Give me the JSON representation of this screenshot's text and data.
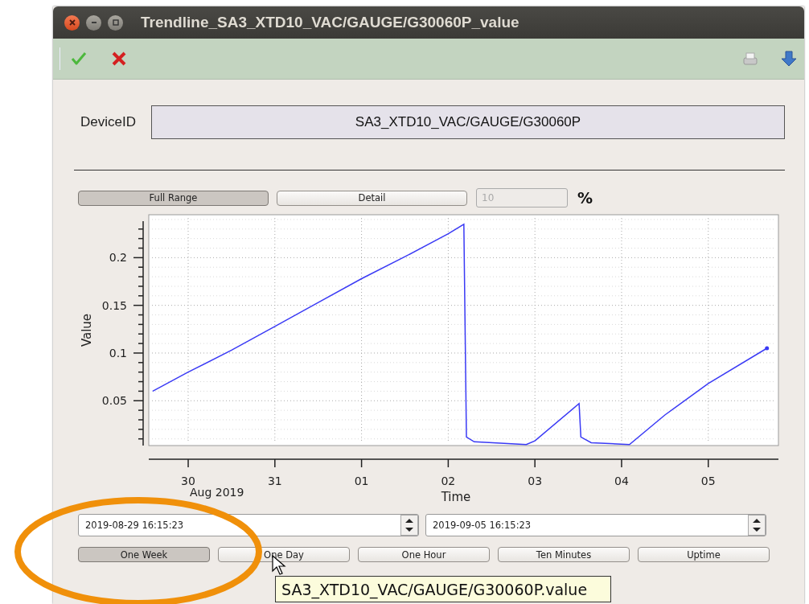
{
  "window": {
    "title": "Trendline_SA3_XTD10_VAC/GAUGE/G30060P_value"
  },
  "toolbar": {
    "buttons": [
      {
        "kind": "accept"
      },
      {
        "kind": "cancel"
      }
    ],
    "right_buttons": [
      {
        "kind": "print"
      },
      {
        "kind": "download"
      }
    ]
  },
  "device": {
    "label": "DeviceID",
    "value": "SA3_XTD10_VAC/GAUGE/G30060P"
  },
  "range_buttons": [
    {
      "label": "Full Range",
      "selected": true
    },
    {
      "label": "Detail",
      "selected": false
    }
  ],
  "detail_percent": {
    "value": "10",
    "disabled": true,
    "unit": "%"
  },
  "chart": {
    "axis_date": "Aug 2019",
    "chart_data": {
      "type": "line",
      "xlabel": "Time",
      "ylabel": "Value",
      "grid": true,
      "xlim": [
        "2019-08-29T13:05",
        "2019-09-05T19:26"
      ],
      "ylim": [
        0.003,
        0.245
      ],
      "xticks": [
        {
          "value": "2019-08-30",
          "label": "30"
        },
        {
          "value": "2019-08-31",
          "label": "31"
        },
        {
          "value": "2019-09-01",
          "label": "01"
        },
        {
          "value": "2019-09-02",
          "label": "02"
        },
        {
          "value": "2019-09-03",
          "label": "03"
        },
        {
          "value": "2019-09-04",
          "label": "04"
        },
        {
          "value": "2019-09-05",
          "label": "05"
        }
      ],
      "yticks": [
        {
          "value": 0.05,
          "label": "0.05"
        },
        {
          "value": 0.1,
          "label": "0.1"
        },
        {
          "value": 0.15,
          "label": "0.15"
        },
        {
          "value": 0.2,
          "label": "0.2"
        }
      ],
      "x": [
        "2019-08-29T14:10",
        "2019-08-30T00:00",
        "2019-08-30T12:00",
        "2019-08-31T00:00",
        "2019-08-31T12:00",
        "2019-09-01T00:00",
        "2019-09-01T12:00",
        "2019-09-02T00:00",
        "2019-09-02T04:19",
        "2019-09-02T05:02",
        "2019-09-02T07:12",
        "2019-09-02T21:36",
        "2019-09-03T00:00",
        "2019-09-03T12:14",
        "2019-09-03T12:43",
        "2019-09-03T15:36",
        "2019-09-04T02:10",
        "2019-09-04T12:00",
        "2019-09-05T00:00",
        "2019-09-05T16:15"
      ],
      "series": [
        {
          "color": "#3a3af5",
          "values": [
            0.06,
            0.08,
            0.103,
            0.128,
            0.153,
            0.178,
            0.201,
            0.225,
            0.235,
            0.012,
            0.007,
            0.004,
            0.008,
            0.047,
            0.012,
            0.006,
            0.004,
            0.035,
            0.068,
            0.105
          ]
        }
      ]
    }
  },
  "time_fields": [
    {
      "value": "2019-08-29 16:15:23"
    },
    {
      "value": "2019-09-05 16:15:23"
    }
  ],
  "period_buttons": [
    {
      "label": "One Week",
      "selected": true
    },
    {
      "label": "One Day",
      "selected": false
    },
    {
      "label": "One Hour",
      "selected": false
    },
    {
      "label": "Ten Minutes",
      "selected": false
    },
    {
      "label": "Uptime",
      "selected": false
    }
  ],
  "tooltip": {
    "text": "SA3_XTD10_VAC/GAUGE/G30060P.value"
  },
  "annotation": {
    "kind": "ellipse",
    "color": "#f0900a"
  }
}
